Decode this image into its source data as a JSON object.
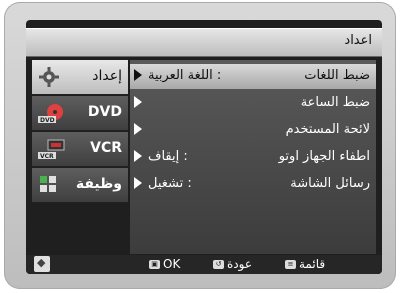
{
  "title": "اعداد",
  "sidebar": {
    "items": [
      {
        "label": "إعداد",
        "icon": "gear-icon",
        "active": true
      },
      {
        "label": "DVD",
        "icon": "dvd-disc-icon",
        "active": false
      },
      {
        "label": "VCR",
        "icon": "vcr-cassette-icon",
        "active": false
      },
      {
        "label": "وظيفة",
        "icon": "function-grid-icon",
        "active": false
      }
    ]
  },
  "menu": {
    "rows": [
      {
        "label": "ضبط اللغات",
        "value": ": اللغة العربية",
        "selected": true
      },
      {
        "label": "ضبط الساعة",
        "value": "",
        "selected": false
      },
      {
        "label": "لائحة المستخدم",
        "value": "",
        "selected": false
      },
      {
        "label": "اطفاء الجهاز اوتو",
        "value": ": إيقاف",
        "selected": false
      },
      {
        "label": "رسائل الشاشة",
        "value": ": تشغيل",
        "selected": false
      }
    ]
  },
  "footer": {
    "ok_label": "OK",
    "back_label": "عودة",
    "menu_label": "قائمة"
  }
}
